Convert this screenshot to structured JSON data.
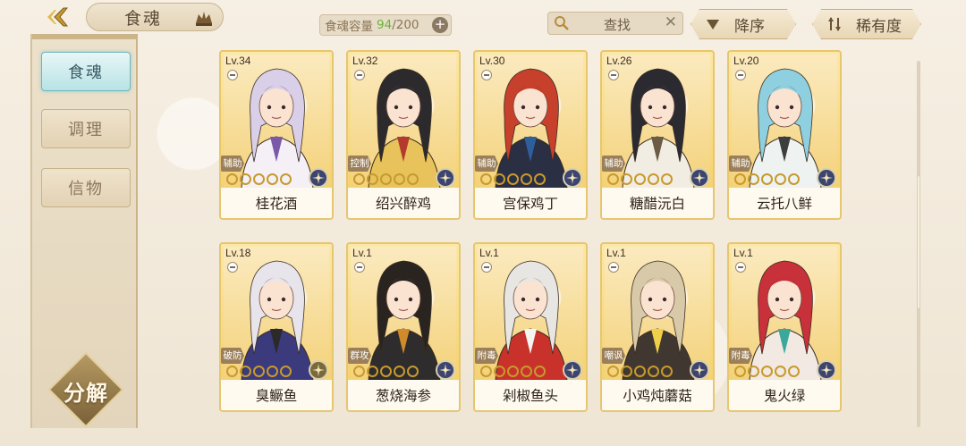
{
  "header": {
    "title": "食魂",
    "capacity_label": "食魂容量",
    "capacity_current": "94",
    "capacity_max": "/200",
    "capacity_add": "+",
    "search_label": "查找",
    "search_clear": "✕",
    "sort_order_label": "降序",
    "sort_rarity_label": "稀有度"
  },
  "sidebar": {
    "items": [
      {
        "label": "食魂",
        "active": true
      },
      {
        "label": "调理",
        "active": false
      },
      {
        "label": "信物",
        "active": false
      }
    ],
    "decompose_label": "分解"
  },
  "cards": [
    {
      "level": "Lv.34",
      "role": "辅助",
      "name": "桂花酒",
      "hair": "#d9cfe8",
      "outfit": "#f4f0f6",
      "accent": "#7a5aa8"
    },
    {
      "level": "Lv.32",
      "role": "控制",
      "name": "绍兴醉鸡",
      "hair": "#2d2a2e",
      "outfit": "#e8c25a",
      "accent": "#b33a2c"
    },
    {
      "level": "Lv.30",
      "role": "辅助",
      "name": "宫保鸡丁",
      "hair": "#c6402b",
      "outfit": "#2a2f44",
      "accent": "#2f5f9a"
    },
    {
      "level": "Lv.26",
      "role": "辅助",
      "name": "糖醋沅白",
      "hair": "#2a2a30",
      "outfit": "#f1ede3",
      "accent": "#6c5b45"
    },
    {
      "level": "Lv.20",
      "role": "辅助",
      "name": "云托八鲜",
      "hair": "#8fd0e0",
      "outfit": "#eef2f1",
      "accent": "#3d3d3d"
    },
    {
      "level": "Lv.18",
      "role": "破防",
      "name": "臭鳜鱼",
      "hair": "#e8e4ec",
      "outfit": "#3a3a7c",
      "accent": "#2a2a2a"
    },
    {
      "level": "Lv.1",
      "role": "群攻",
      "name": "葱烧海参",
      "hair": "#2a2420",
      "outfit": "#2e2c2c",
      "accent": "#d08a2a"
    },
    {
      "level": "Lv.1",
      "role": "附毒",
      "name": "剁椒鱼头",
      "hair": "#e7e6e2",
      "outfit": "#c8322a",
      "accent": "#f4f4f0"
    },
    {
      "level": "Lv.1",
      "role": "嘲讽",
      "name": "小鸡炖蘑菇",
      "hair": "#d8c9a8",
      "outfit": "#403830",
      "accent": "#f0d04a"
    },
    {
      "level": "Lv.1",
      "role": "附毒",
      "name": "鬼火绿",
      "hair": "#c8303a",
      "outfit": "#f1e9e2",
      "accent": "#3aa89a"
    }
  ],
  "icons": {
    "back": "back-arrow-icon",
    "crown": "crown-icon",
    "search": "magnifier-icon",
    "sort_desc": "triangle-down-icon",
    "sort_rarity": "sort-arrows-icon",
    "lock": "lock-toggle-icon",
    "star": "ring-star-icon",
    "emblem": "compass-emblem-icon"
  },
  "colors": {
    "capacity_current": "#6cb23a",
    "active_tab": "#b8e3e6",
    "card_gold": "#f3cd62"
  }
}
